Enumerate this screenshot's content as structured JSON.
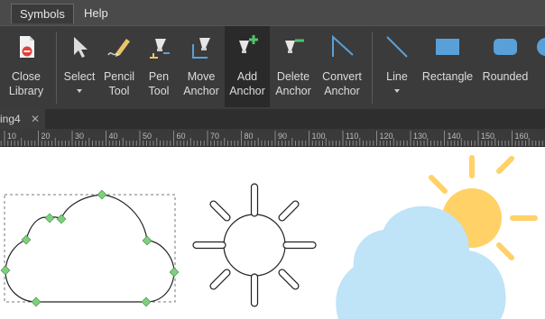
{
  "menubar": {
    "items": [
      "Symbols",
      "Help"
    ],
    "active": "Symbols"
  },
  "ribbon": {
    "tools": [
      {
        "name": "close-library",
        "label": "Close\nLibrary",
        "icon": "close-library-icon"
      },
      {
        "name": "select",
        "label": "Select",
        "icon": "select-arrow-icon",
        "dropdown": true
      },
      {
        "name": "pencil-tool",
        "label": "Pencil\nTool",
        "icon": "pencil-icon"
      },
      {
        "name": "pen-tool",
        "label": "Pen\nTool",
        "icon": "pen-icon"
      },
      {
        "name": "move-anchor",
        "label": "Move\nAnchor",
        "icon": "move-anchor-icon"
      },
      {
        "name": "add-anchor",
        "label": "Add\nAnchor",
        "icon": "add-anchor-icon",
        "active": true
      },
      {
        "name": "delete-anchor",
        "label": "Delete\nAnchor",
        "icon": "delete-anchor-icon"
      },
      {
        "name": "convert-anchor",
        "label": "Convert\nAnchor",
        "icon": "convert-anchor-icon"
      },
      {
        "name": "line",
        "label": "Line",
        "icon": "line-icon",
        "dropdown": true
      },
      {
        "name": "rectangle",
        "label": "Rectangle",
        "icon": "rectangle-icon"
      },
      {
        "name": "rounded",
        "label": "Rounded",
        "icon": "rounded-rectangle-icon"
      }
    ],
    "accent_color": "#5aa0d8"
  },
  "document_tab": {
    "label": "ing4",
    "close": "✕"
  },
  "ruler": {
    "ticks": [
      "10",
      "20",
      "30",
      "40",
      "50",
      "60",
      "70",
      "80",
      "90",
      "100",
      "110",
      "120",
      "130",
      "140",
      "150",
      "160"
    ]
  },
  "canvas": {
    "shapes": [
      "cloud-outline",
      "sun-outline",
      "sun-behind-cloud"
    ],
    "colors": {
      "sun": "#ffd166",
      "cloud": "#bfe3f7",
      "anchor": "#7ed07e"
    }
  }
}
